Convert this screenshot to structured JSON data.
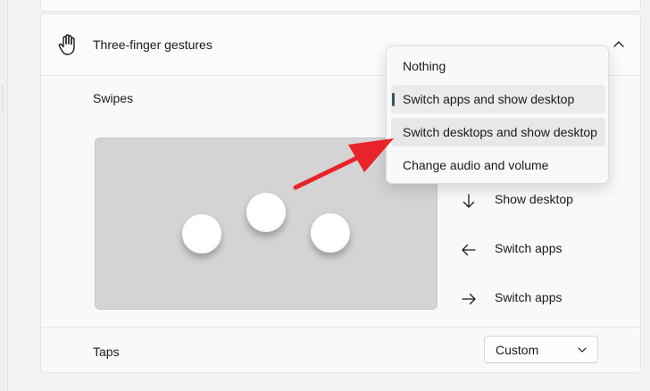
{
  "section": {
    "title": "Three-finger gestures",
    "icon": "hand-icon",
    "expand_icon": "chevron-up-icon"
  },
  "swipes": {
    "label": "Swipes",
    "dropdown": {
      "options": [
        "Nothing",
        "Switch apps and show desktop",
        "Switch desktops and show desktop",
        "Change audio and volume"
      ],
      "selected": "Switch apps and show desktop",
      "hovered": "Switch desktops and show desktop"
    },
    "gestures": [
      {
        "icon": "arrow-down-icon",
        "label": "Show desktop"
      },
      {
        "icon": "arrow-left-icon",
        "label": "Switch apps"
      },
      {
        "icon": "arrow-right-icon",
        "label": "Switch apps"
      }
    ]
  },
  "taps": {
    "label": "Taps",
    "value": "Custom",
    "icon": "chevron-down-icon"
  },
  "colors": {
    "annotation_arrow": "#e8232a",
    "selection_indicator": "#3b5361"
  }
}
